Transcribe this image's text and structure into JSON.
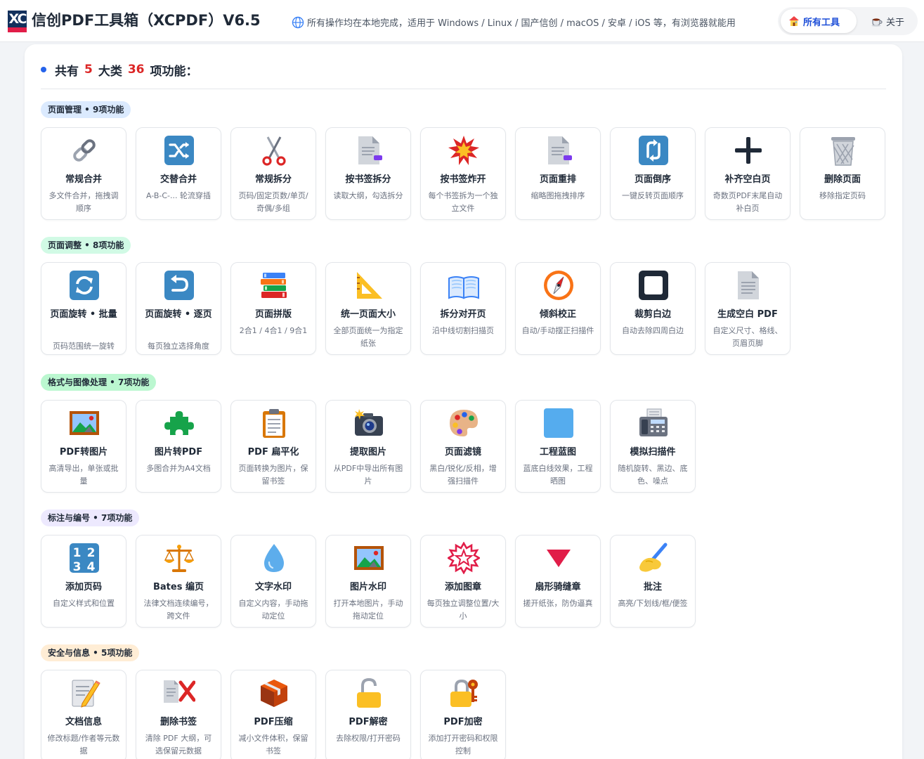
{
  "header": {
    "logo_text": "XC",
    "title": "信创PDF工具箱（XCPDF）V6.5",
    "tagline": "所有操作均在本地完成，适用于 Windows / Linux / 国产信创 / macOS / 安卓 / iOS 等，有浏览器就能用",
    "nav": [
      {
        "label": "所有工具",
        "icon": "house-icon",
        "active": true
      },
      {
        "label": "关于",
        "icon": "coffee-icon",
        "active": false
      }
    ]
  },
  "summary": {
    "prefix": "共有",
    "categories_count": "5",
    "middle": "大类",
    "functions_count": "36",
    "suffix": "项功能："
  },
  "categories": [
    {
      "label": "页面管理 • 9项功能",
      "color": "#dbeafe",
      "tools": [
        {
          "title": "常规合并",
          "desc": "多文件合并，拖拽调顺序",
          "icon": "chain-link-icon"
        },
        {
          "title": "交替合并",
          "desc": "A-B-C-... 轮流穿插",
          "icon": "shuffle-icon"
        },
        {
          "title": "常规拆分",
          "desc": "页码/固定页数/单页/奇偶/多组",
          "icon": "scissors-icon"
        },
        {
          "title": "按书签拆分",
          "desc": "读取大纲，勾选拆分",
          "icon": "bookmark-doc-icon"
        },
        {
          "title": "按书签炸开",
          "desc": "每个书签拆为一个独立文件",
          "icon": "explosion-icon"
        },
        {
          "title": "页面重排",
          "desc": "缩略图拖拽排序",
          "icon": "page-doc-icon"
        },
        {
          "title": "页面倒序",
          "desc": "一键反转页面顺序",
          "icon": "reverse-arrows-icon"
        },
        {
          "title": "补齐空白页",
          "desc": "奇数页PDF末尾自动补白页",
          "icon": "plus-icon"
        },
        {
          "title": "删除页面",
          "desc": "移除指定页码",
          "icon": "trash-can-icon"
        }
      ]
    },
    {
      "label": "页面调整 • 8项功能",
      "color": "#d1fae5",
      "tools": [
        {
          "title": "页面旋转 • 批量",
          "desc": "页码范围统一旋转",
          "icon": "rotate-arrows-icon"
        },
        {
          "title": "页面旋转 • 逐页",
          "desc": "每页独立选择角度",
          "icon": "return-arrow-icon"
        },
        {
          "title": "页面拼版",
          "desc": "2合1 / 4合1 / 9合1",
          "icon": "books-stack-icon"
        },
        {
          "title": "统一页面大小",
          "desc": "全部页面统一为指定纸张",
          "icon": "triangle-ruler-icon"
        },
        {
          "title": "拆分对开页",
          "desc": "沿中线切割扫描页",
          "icon": "open-book-icon"
        },
        {
          "title": "倾斜校正",
          "desc": "自动/手动摆正扫描件",
          "icon": "compass-icon"
        },
        {
          "title": "裁剪白边",
          "desc": "自动去除四周白边",
          "icon": "square-frame-icon"
        },
        {
          "title": "生成空白 PDF",
          "desc": "自定义尺寸、格线、页眉页脚",
          "icon": "blank-doc-icon"
        }
      ]
    },
    {
      "label": "格式与图像处理 • 7项功能",
      "color": "#bbf7d0",
      "tools": [
        {
          "title": "PDF转图片",
          "desc": "高清导出，单张或批量",
          "icon": "framed-picture-icon"
        },
        {
          "title": "图片转PDF",
          "desc": "多图合并为A4文档",
          "icon": "puzzle-piece-icon"
        },
        {
          "title": "PDF 扁平化",
          "desc": "页面转换为图片，保留书签",
          "icon": "clipboard-icon"
        },
        {
          "title": "提取图片",
          "desc": "从PDF中导出所有图片",
          "icon": "camera-flash-icon"
        },
        {
          "title": "页面滤镜",
          "desc": "黑白/锐化/反相，增强扫描件",
          "icon": "palette-icon"
        },
        {
          "title": "工程蓝图",
          "desc": "蓝底白线效果，工程晒图",
          "icon": "blue-square-icon"
        },
        {
          "title": "模拟扫描件",
          "desc": "随机旋转、黑边、底色、噪点",
          "icon": "fax-machine-icon"
        }
      ]
    },
    {
      "label": "标注与编号 • 7项功能",
      "color": "#ede9fe",
      "tools": [
        {
          "title": "添加页码",
          "desc": "自定义样式和位置",
          "icon": "numbers-1234-icon"
        },
        {
          "title": "Bates 编页",
          "desc": "法律文档连续编号，跨文件",
          "icon": "balance-scale-icon"
        },
        {
          "title": "文字水印",
          "desc": "自定义内容，手动拖动定位",
          "icon": "droplet-icon"
        },
        {
          "title": "图片水印",
          "desc": "打开本地图片，手动拖动定位",
          "icon": "framed-picture-icon"
        },
        {
          "title": "添加图章",
          "desc": "每页独立调整位置/大小",
          "icon": "stamp-seal-icon"
        },
        {
          "title": "扇形骑缝章",
          "desc": "搓开纸张，防伪逼真",
          "icon": "red-triangle-icon"
        },
        {
          "title": "批注",
          "desc": "高亮/下划线/框/便签",
          "icon": "writing-hand-icon"
        }
      ]
    },
    {
      "label": "安全与信息 • 5项功能",
      "color": "#ffedd5",
      "tools": [
        {
          "title": "文档信息",
          "desc": "修改标题/作者等元数据",
          "icon": "memo-pencil-icon"
        },
        {
          "title": "删除书签",
          "desc": "清除 PDF 大纲，可选保留元数据",
          "icon": "doc-cross-icon"
        },
        {
          "title": "PDF压缩",
          "desc": "减小文件体积，保留书签",
          "icon": "package-box-icon"
        },
        {
          "title": "PDF解密",
          "desc": "去除权限/打开密码",
          "icon": "unlocked-padlock-icon"
        },
        {
          "title": "PDF加密",
          "desc": "添加打开密码和权限控制",
          "icon": "locked-key-icon"
        }
      ]
    }
  ]
}
